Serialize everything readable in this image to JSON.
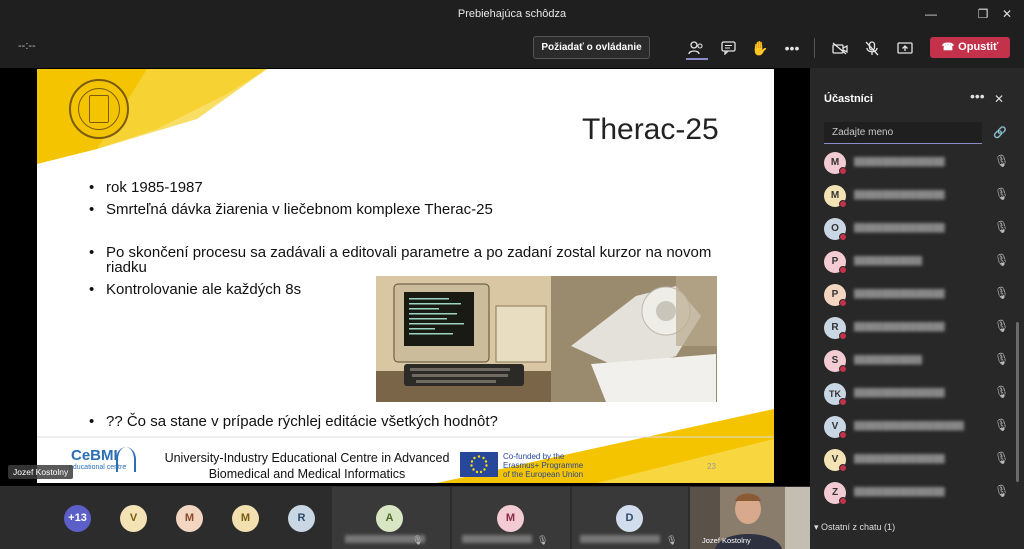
{
  "window": {
    "title": "Prebiehajúca schôdza",
    "minimize_icon": "minimize-icon",
    "maximize_icon": "restore-icon",
    "close_icon": "close-icon"
  },
  "toolbar": {
    "timer": "--:--",
    "request_control_label": "Požiadať o ovládanie",
    "leave_label": "Opustiť",
    "icons": [
      "participants-icon",
      "chat-icon",
      "raise-hand-icon",
      "more-icon",
      "camera-off-icon",
      "mic-off-icon",
      "share-icon",
      "phone-hangup-icon"
    ],
    "accent": "#8b8cc7",
    "leave_color": "#c4314b"
  },
  "slide": {
    "title": "Therac-25",
    "bullets_top": [
      "rok 1985-1987",
      "Smrteľná dávka žiarenia v liečebnom komplexe Therac-25"
    ],
    "bullets_mid": [
      "Po skončení procesu sa zadávali a editovali parametre a po zadaní zostal kurzor na novom riadku",
      "Kontrolovanie ale každých 8s"
    ],
    "bullets_bottom": [
      "?? Čo sa stane v prípade rýchlej editácie všetkých hodnôt?"
    ],
    "logo_text": "ŽILINSKÁ UNIVERZITA V ŽILINE · UNIVERSITAS SOLNENSIS",
    "footer_line1": "University-Industry Educational Centre in Advanced",
    "footer_line2": "Biomedical and Medical Informatics",
    "cebmi": "CeBMI",
    "cebmi_sub": "educational centre",
    "eu_line1": "Co-funded by the",
    "eu_line2": "Erasmus+ Programme",
    "eu_line3": "of the European Union",
    "page_number": "23",
    "accent": "#f5c400"
  },
  "presenter_tag": "Jozef Kostolny",
  "strip": {
    "more_count": "+13",
    "avatars": [
      {
        "initial": "V",
        "color": "#f4e3b5"
      },
      {
        "initial": "M",
        "color": "#f2d6c2"
      },
      {
        "initial": "M",
        "color": "#f2e0b0"
      },
      {
        "initial": "R",
        "color": "#c9d6e3"
      }
    ],
    "tiles": [
      {
        "initial": "A",
        "color": "#d9e6c4"
      },
      {
        "initial": "M",
        "color": "#f2cbd3"
      },
      {
        "initial": "D",
        "color": "#d1dcec"
      }
    ],
    "video_name": "Jozef Kostolny"
  },
  "panel": {
    "title": "Účastníci",
    "search_placeholder": "Zadajte meno",
    "participants": [
      {
        "initial": "M",
        "color": "#f2cbd3"
      },
      {
        "initial": "M",
        "color": "#f4e3b5"
      },
      {
        "initial": "O",
        "color": "#c9d6e3"
      },
      {
        "initial": "P",
        "color": "#f2cbd3"
      },
      {
        "initial": "P",
        "color": "#f2d6c2"
      },
      {
        "initial": "R",
        "color": "#c9d6e3"
      },
      {
        "initial": "S",
        "color": "#f2cbd3"
      },
      {
        "initial": "TK",
        "color": "#c9d6e3"
      },
      {
        "initial": "V",
        "color": "#c9d6e3"
      },
      {
        "initial": "V",
        "color": "#f4e3b5"
      },
      {
        "initial": "Z",
        "color": "#f2cbd3"
      }
    ],
    "others_label": "Ostatní z chatu (1)"
  }
}
